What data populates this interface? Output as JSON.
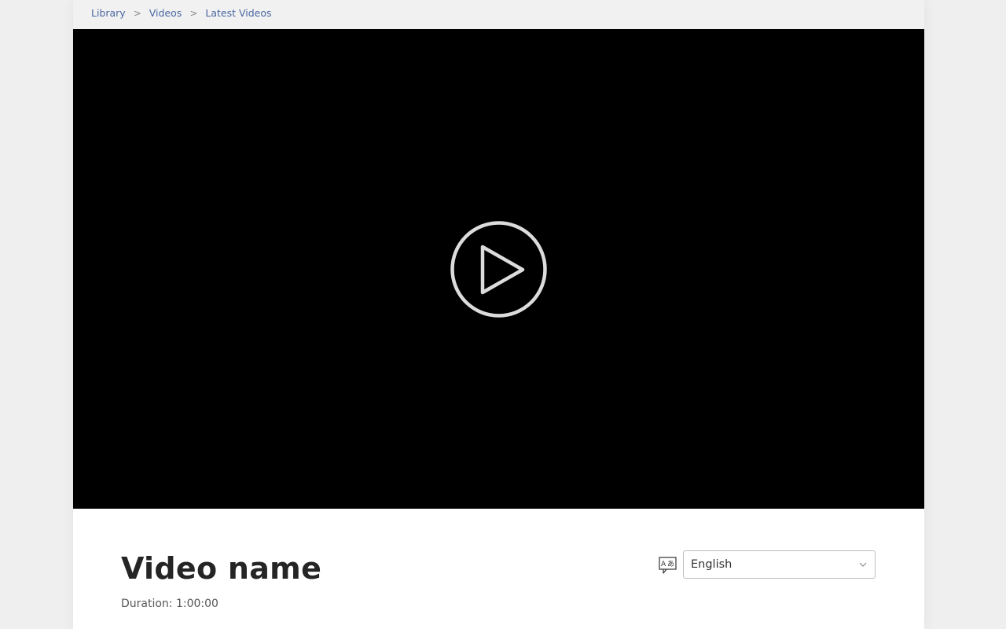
{
  "breadcrumb": {
    "items": [
      "Library",
      "Videos",
      "Latest Videos"
    ],
    "separator": ">"
  },
  "player": {
    "background": "#000000",
    "icon": "play-icon"
  },
  "video": {
    "title": "Video name",
    "duration": "Duration: 1:00:00"
  },
  "language": {
    "icon": "translate-icon",
    "selected": "English"
  },
  "colors": {
    "link": "#4a67a1",
    "title": "#252525"
  }
}
